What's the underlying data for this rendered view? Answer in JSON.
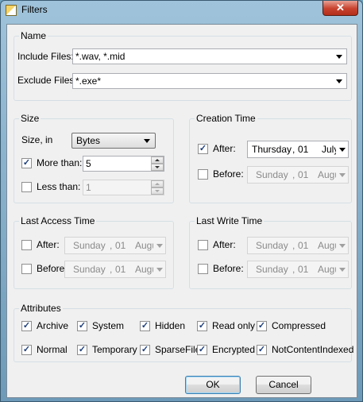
{
  "window": {
    "title": "Filters",
    "close_label": "✕"
  },
  "name_group": {
    "legend": "Name",
    "include_label": "Include Files:",
    "include_value": "*.wav, *.mid",
    "exclude_label": "Exclude Files:",
    "exclude_value": "*.exe*"
  },
  "size_group": {
    "legend": "Size",
    "size_in_label": "Size, in",
    "units_value": "Bytes",
    "more_than": {
      "label": "More than:",
      "checked": true,
      "value": "5"
    },
    "less_than": {
      "label": "Less than:",
      "checked": false,
      "value": "1"
    }
  },
  "creation_group": {
    "legend": "Creation Time",
    "after": {
      "label": "After:",
      "checked": true,
      "day": "Thursday",
      "date": "01",
      "month": "July"
    },
    "before": {
      "label": "Before:",
      "checked": false,
      "day": "Sunday",
      "date": "01",
      "month": "Augu"
    }
  },
  "last_access_group": {
    "legend": "Last Access Time",
    "after": {
      "label": "After:",
      "checked": false,
      "day": "Sunday",
      "date": "01",
      "month": "Augu"
    },
    "before": {
      "label": "Before:",
      "checked": false,
      "day": "Sunday",
      "date": "01",
      "month": "Augu"
    }
  },
  "last_write_group": {
    "legend": "Last Write Time",
    "after": {
      "label": "After:",
      "checked": false,
      "day": "Sunday",
      "date": "01",
      "month": "Augu"
    },
    "before": {
      "label": "Before:",
      "checked": false,
      "day": "Sunday",
      "date": "01",
      "month": "Augu"
    }
  },
  "attributes_group": {
    "legend": "Attributes",
    "archive": "Archive",
    "system": "System",
    "hidden": "Hidden",
    "read_only": "Read only",
    "compressed": "Compressed",
    "normal": "Normal",
    "temporary": "Temporary",
    "sparse_file": "SparseFile",
    "encrypted": "Encrypted",
    "not_content_indexed": "NotContentIndexed",
    "check_mark": "✓"
  },
  "buttons": {
    "ok": "OK",
    "cancel": "Cancel"
  }
}
